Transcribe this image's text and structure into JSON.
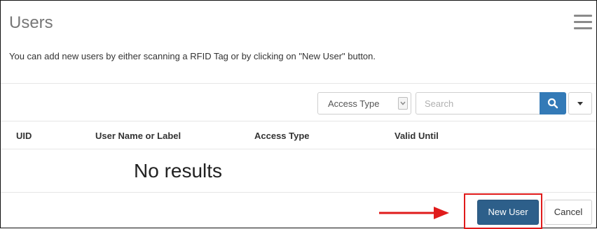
{
  "header": {
    "title": "Users",
    "menu_icon": "hamburger-menu-icon"
  },
  "description": "You can add new users by either scanning a RFID Tag or by clicking on \"New User\" button.",
  "toolbar": {
    "filter_label": "Access Type",
    "search_placeholder": "Search",
    "search_icon": "search-icon",
    "dropdown_icon": "caret-down-icon"
  },
  "table": {
    "columns": [
      "UID",
      "User Name or Label",
      "Access Type",
      "Valid Until"
    ],
    "rows": [],
    "empty_message": "No results"
  },
  "footer": {
    "new_user_label": "New User",
    "cancel_label": "Cancel"
  },
  "annotation": {
    "color": "#e01b1b",
    "arrow_icon": "arrow-right-icon"
  },
  "colors": {
    "primary": "#337ab7",
    "primary_dark": "#2d5f8a"
  }
}
